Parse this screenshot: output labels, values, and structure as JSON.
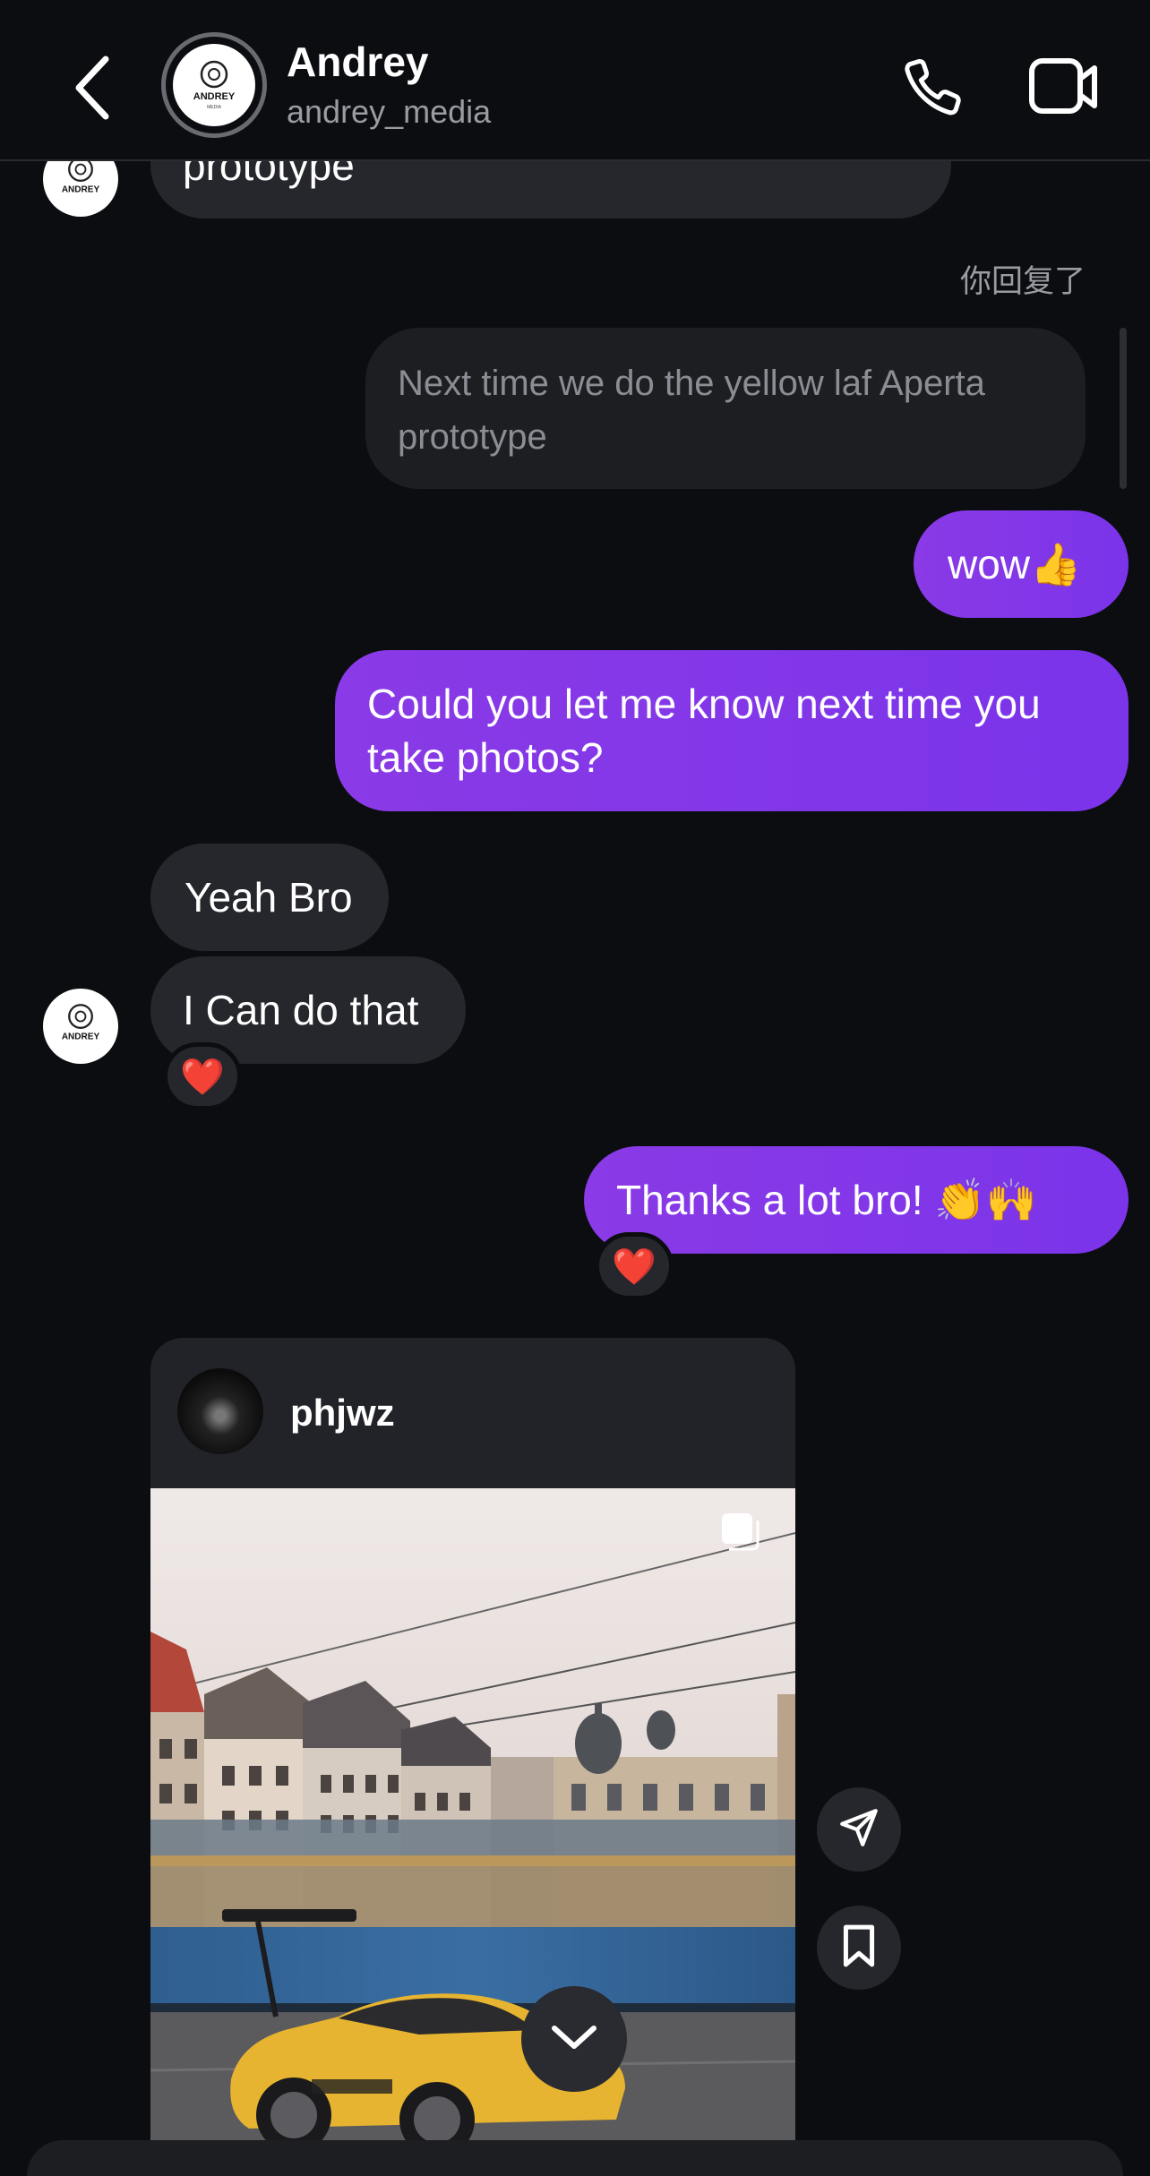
{
  "header": {
    "back_icon": "chevron-left-icon",
    "name": "Andrey",
    "username": "andrey_media",
    "avatar_text": "ANDREY",
    "avatar_subtext": "MEDIA",
    "call_icon": "phone-icon",
    "video_icon": "video-camera-icon"
  },
  "messages": {
    "top_partial": "prototype",
    "reply_label": "你回复了",
    "reply_quote": "Next time we do the yellow laf Aperta prototype",
    "out_wow": "wow👍",
    "out_could": "Could you let me know next time you take photos?",
    "in_yeah": "Yeah Bro",
    "in_can": "I Can do that",
    "heart_reaction": "❤️",
    "out_thanks": "Thanks a lot bro! 👏🙌"
  },
  "shared_post": {
    "username": "phjwz",
    "share_icon": "paper-plane-icon",
    "save_icon": "bookmark-icon",
    "multi_icon": "carousel-icon",
    "scroll_down_icon": "chevron-down-icon"
  },
  "colors": {
    "background": "#0c0d11",
    "incoming_bubble": "#26272c",
    "outgoing_bubble": "#8a3ae6",
    "secondary_text": "#9a9ba3"
  }
}
